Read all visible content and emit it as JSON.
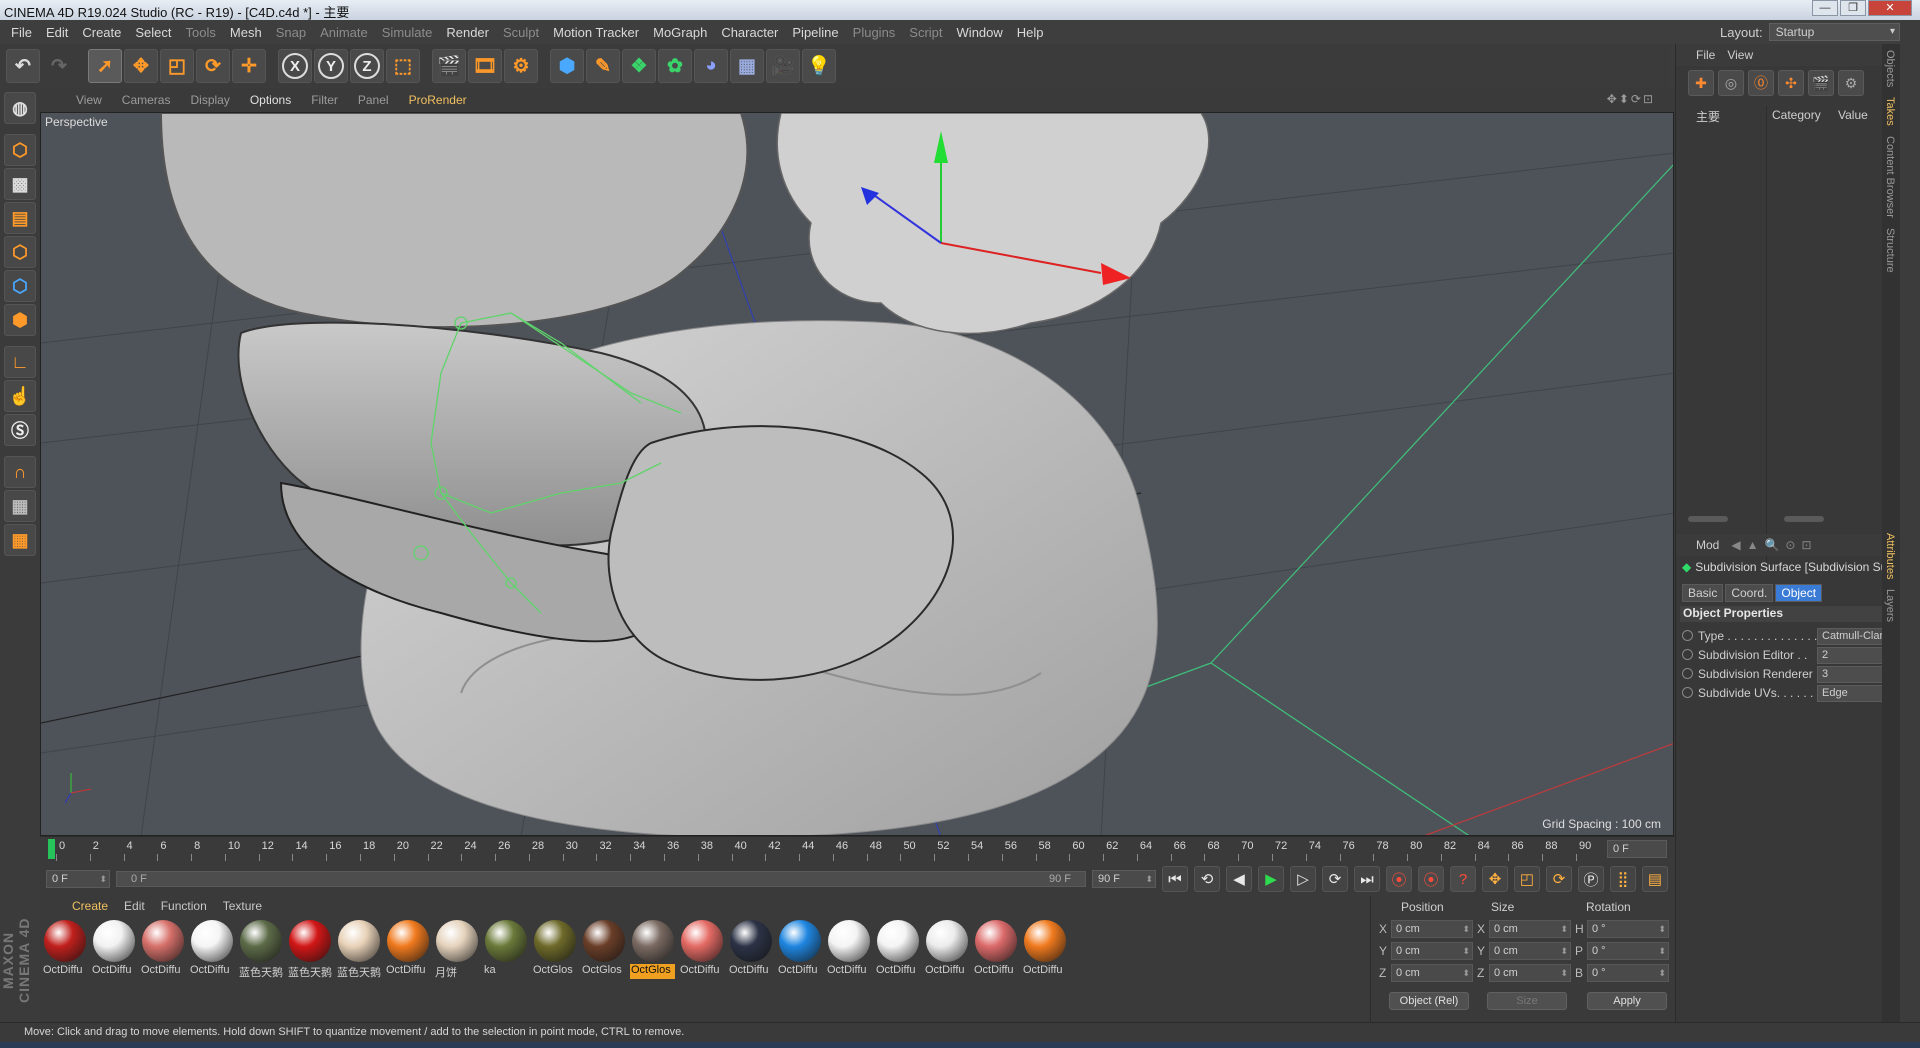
{
  "window": {
    "title": "CINEMA 4D R19.024 Studio (RC - R19) - [C4D.c4d *] - 主要"
  },
  "menu": [
    "File",
    "Edit",
    "Create",
    "Select",
    "Tools",
    "Mesh",
    "Snap",
    "Animate",
    "Simulate",
    "Render",
    "Sculpt",
    "Motion Tracker",
    "MoGraph",
    "Character",
    "Pipeline",
    "Plugins",
    "Script",
    "Window",
    "Help"
  ],
  "menu_dim": [
    "Tools",
    "Snap",
    "Animate",
    "Simulate",
    "Sculpt",
    "Plugins",
    "Script"
  ],
  "layout": {
    "label": "Layout:",
    "value": "Startup"
  },
  "toolbar": {
    "x_label": "X",
    "y_label": "Y",
    "z_label": "Z"
  },
  "viewport_menu": {
    "items": [
      "View",
      "Cameras",
      "Display",
      "Options",
      "Filter",
      "Panel",
      "ProRender"
    ],
    "active": "Options"
  },
  "viewport": {
    "camera": "Perspective",
    "grid_spacing": "Grid Spacing : 100 cm"
  },
  "timeline": {
    "ticks": [
      "0",
      "2",
      "4",
      "6",
      "8",
      "10",
      "12",
      "14",
      "16",
      "18",
      "20",
      "22",
      "24",
      "26",
      "28",
      "30",
      "32",
      "34",
      "36",
      "38",
      "40",
      "42",
      "44",
      "46",
      "48",
      "50",
      "52",
      "54",
      "56",
      "58",
      "60",
      "62",
      "64",
      "66",
      "68",
      "70",
      "72",
      "74",
      "76",
      "78",
      "80",
      "82",
      "84",
      "86",
      "88",
      "90"
    ],
    "current_frame": "0 F"
  },
  "transport": {
    "start": "0 F",
    "range_start": "0 F",
    "range_end": "90 F",
    "end": "90 F"
  },
  "material_menu": {
    "items": [
      "Create",
      "Edit",
      "Function",
      "Texture"
    ],
    "active": "Create"
  },
  "materials": [
    {
      "label": "OctDiffu",
      "color": "#c0201c"
    },
    {
      "label": "OctDiffu",
      "color": "#f2f2f2"
    },
    {
      "label": "OctDiffu",
      "color": "#d6706a"
    },
    {
      "label": "OctDiffu",
      "color": "#f5f5f5"
    },
    {
      "label": "蓝色天鹅",
      "color": "#5d6b48"
    },
    {
      "label": "蓝色天鹅",
      "color": "#d21616"
    },
    {
      "label": "蓝色天鹅",
      "color": "#e8d2b8"
    },
    {
      "label": "OctDiffu",
      "color": "#f07a1e"
    },
    {
      "label": "月饼",
      "color": "#e5d3bd"
    },
    {
      "label": "ka",
      "color": "#6a7a3a"
    },
    {
      "label": "OctGlos",
      "color": "#6e6a2a"
    },
    {
      "label": "OctGlos",
      "color": "#6a3e28"
    },
    {
      "label": "OctGlos",
      "color": "#7a6a62"
    },
    {
      "label": "OctDiffu",
      "color": "#e46a64"
    },
    {
      "label": "OctDiffu",
      "color": "#2c3346"
    },
    {
      "label": "OctDiffu",
      "color": "#1f86e0"
    },
    {
      "label": "OctDiffu",
      "color": "#f4f4f4"
    },
    {
      "label": "OctDiffu",
      "color": "#f4f4f4"
    },
    {
      "label": "OctDiffu",
      "color": "#ececec"
    },
    {
      "label": "OctDiffu",
      "color": "#dc6a6a"
    },
    {
      "label": "OctDiffu",
      "color": "#f07a1e"
    }
  ],
  "selected_material_index": 12,
  "coordinates": {
    "headers": {
      "position": "Position",
      "size": "Size",
      "rotation": "Rotation"
    },
    "rows": [
      {
        "axis": "X",
        "pos": "0 cm",
        "size_axis": "X",
        "size": "0 cm",
        "rot_axis": "H",
        "rot": "0 °"
      },
      {
        "axis": "Y",
        "pos": "0 cm",
        "size_axis": "Y",
        "size": "0 cm",
        "rot_axis": "P",
        "rot": "0 °"
      },
      {
        "axis": "Z",
        "pos": "0 cm",
        "size_axis": "Z",
        "size": "0 cm",
        "rot_axis": "B",
        "rot": "0 °"
      }
    ],
    "mode": "Object (Rel)",
    "size_mode": "Size",
    "apply": "Apply"
  },
  "status": "Move: Click and drag to move elements. Hold down SHIFT to quantize movement / add to the selection in point mode, CTRL to remove.",
  "object_manager": {
    "menu": [
      "File",
      "View"
    ],
    "col_name": "主要",
    "col_category": "Category",
    "col_value": "Value"
  },
  "attributes": {
    "menu": [
      "Mod"
    ],
    "title": "Subdivision Surface [Subdivision Surface]",
    "tabs": [
      "Basic",
      "Coord.",
      "Object"
    ],
    "active_tab": "Object",
    "section": "Object Properties",
    "props": [
      {
        "label": "Type . . . . . . . . . . . . . .",
        "value": "Catmull-Clark"
      },
      {
        "label": "Subdivision Editor . .",
        "value": "2"
      },
      {
        "label": "Subdivision Renderer",
        "value": "3"
      },
      {
        "label": "Subdivide UVs. . . . . .",
        "value": "Edge"
      }
    ]
  },
  "side_tabs": [
    "Objects",
    "Takes",
    "Content Browser",
    "Structure",
    "Attributes",
    "Layers"
  ],
  "side_tabs_active": [
    "Takes",
    "Attributes"
  ],
  "accent": "#f0c060"
}
